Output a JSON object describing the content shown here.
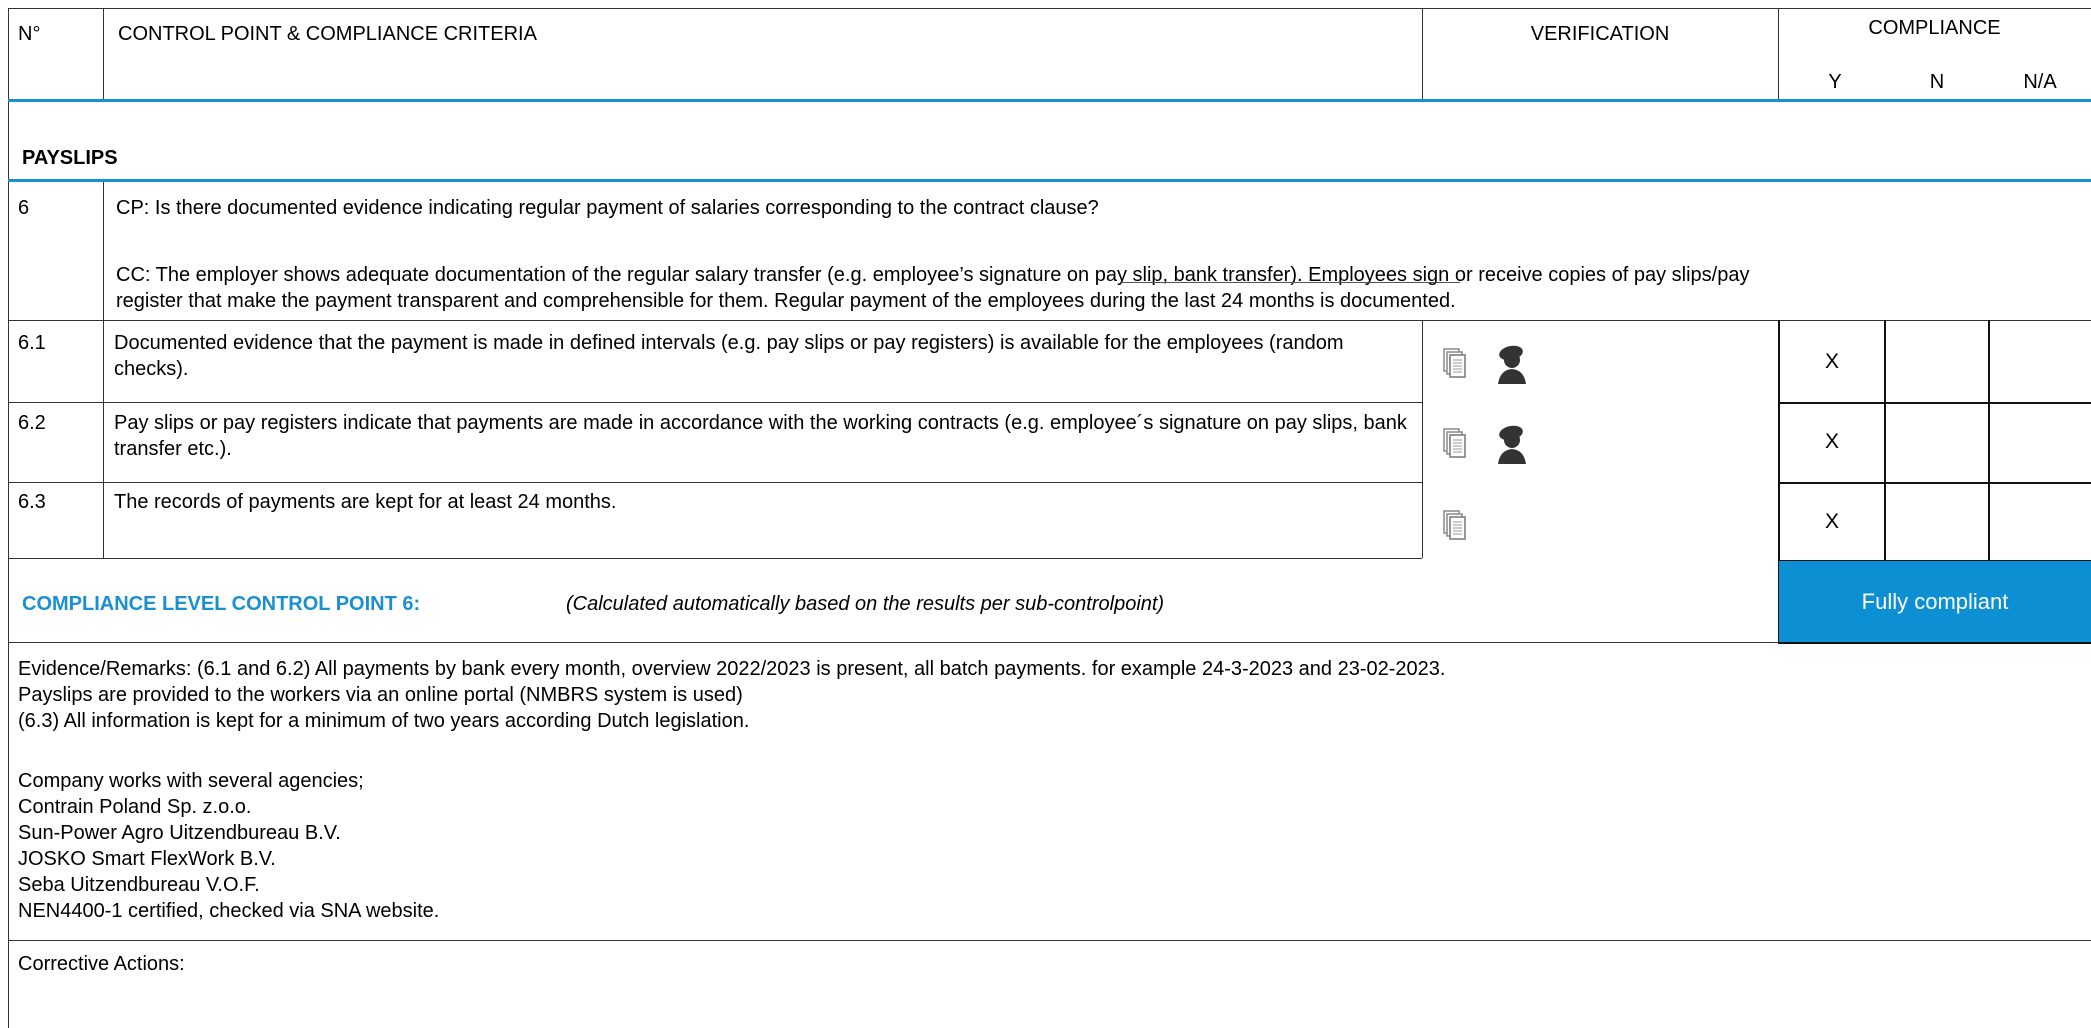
{
  "header": {
    "no_label": "N°",
    "control_point_label": "CONTROL POINT & COMPLIANCE CRITERIA",
    "verification_label": "VERIFICATION",
    "compliance_label": "COMPLIANCE",
    "y_label": "Y",
    "n_label": "N",
    "na_label": "N/A"
  },
  "section": {
    "title": "PAYSLIPS"
  },
  "control_point": {
    "number": "6",
    "question": "CP: Is there documented evidence indicating regular payment of salaries corresponding to the contract clause?",
    "criteria_line1": "CC: The employer shows adequate documentation of the regular salary transfer (e.g. employee’s signature on pay slip, bank transfer). Employees sign or receive copies of pay slips/pay",
    "criteria_line2": "register that make the payment transparent and comprehensible for them. Regular payment of the employees during the last 24 months is documented."
  },
  "sub_points": [
    {
      "number": "6.1",
      "text": "Documented evidence that the payment is made in defined intervals (e.g. pay slips or pay registers) is available for the employees (random checks).",
      "verification_icons": [
        "document-icon",
        "interview-person-icon"
      ],
      "y": "X",
      "n": "",
      "na": ""
    },
    {
      "number": "6.2",
      "text": "Pay slips or pay registers indicate that payments are made in accordance with the working contracts (e.g. employee´s signature on pay slips, bank transfer etc.).",
      "verification_icons": [
        "document-icon",
        "interview-person-icon"
      ],
      "y": "X",
      "n": "",
      "na": ""
    },
    {
      "number": "6.3",
      "text": "The records of payments are kept for at least 24 months.",
      "verification_icons": [
        "document-icon"
      ],
      "y": "X",
      "n": "",
      "na": ""
    }
  ],
  "compliance_level": {
    "label": "COMPLIANCE LEVEL CONTROL POINT 6:",
    "note": "(Calculated automatically based on the results per sub-controlpoint)",
    "result": "Fully compliant"
  },
  "evidence": {
    "lines": [
      "Evidence/Remarks: (6.1 and 6.2) All payments by bank every month, overview 2022/2023 is present, all batch payments. for example 24-3-2023 and 23-02-2023.",
      "Payslips are provided to the workers via an online portal (NMBRS system is used)",
      "(6.3) All information is kept for a minimum of two years according Dutch legislation.",
      "",
      "Company works with several agencies;",
      "Contrain Poland Sp. z.o.o.",
      "Sun-Power Agro Uitzendbureau B.V.",
      "JOSKO Smart FlexWork B.V.",
      "Seba Uitzendbureau V.O.F.",
      "NEN4400-1 certified, checked via SNA website."
    ]
  },
  "corrective_actions": {
    "label": "Corrective Actions:"
  },
  "colors": {
    "accent_blue": "#0d8fd4",
    "label_blue": "#1a90d0"
  }
}
